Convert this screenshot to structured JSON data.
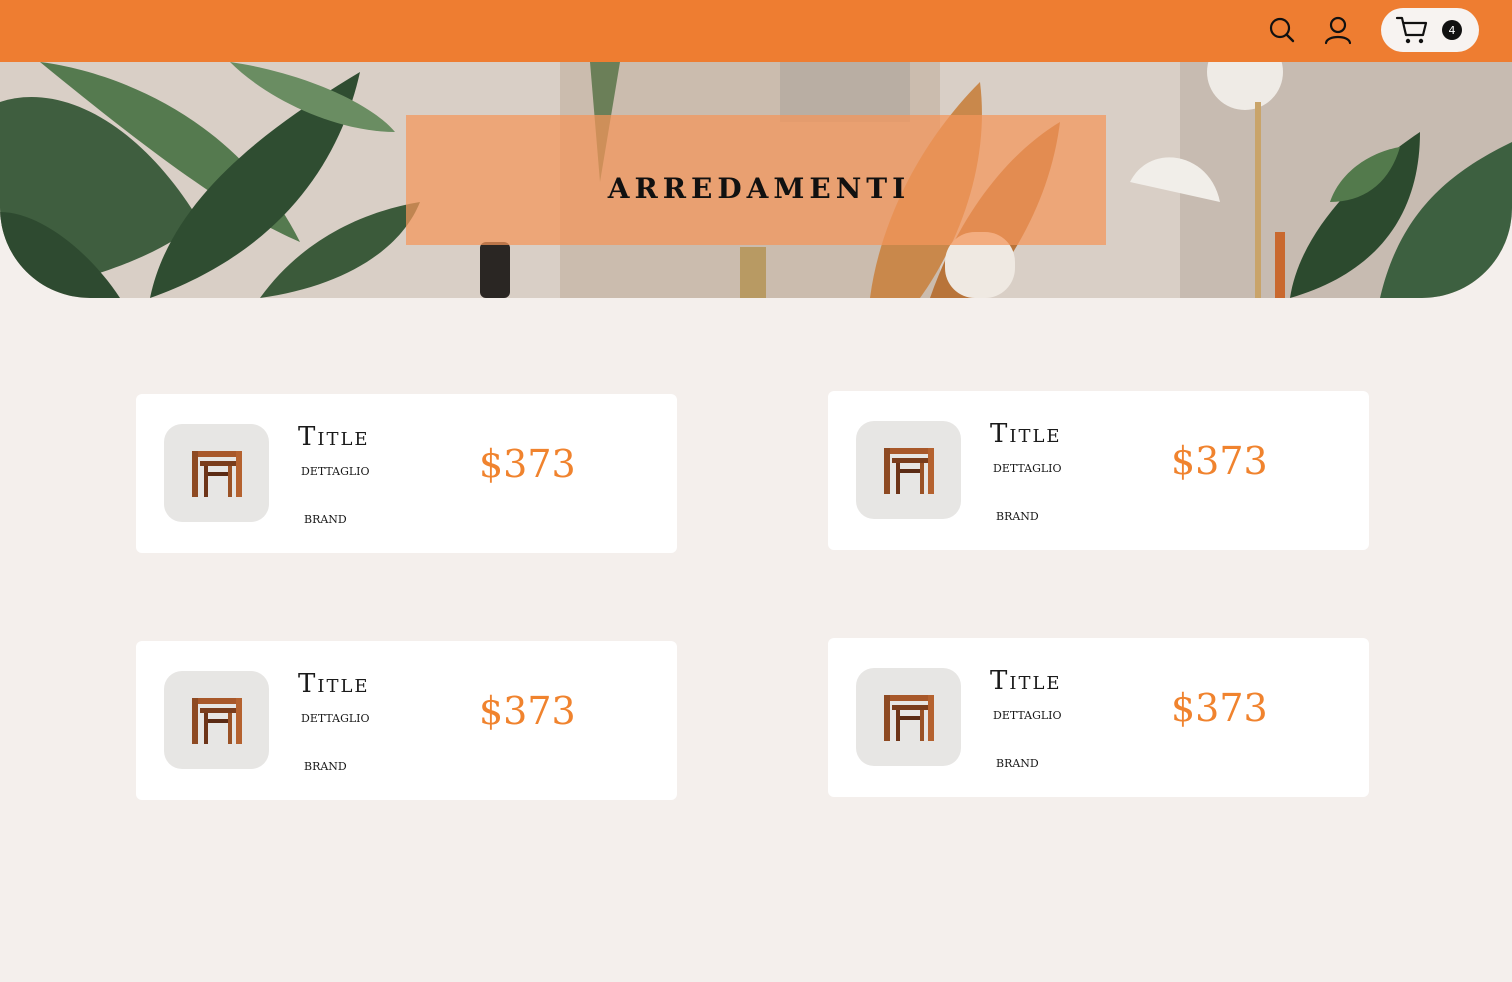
{
  "header": {
    "search_icon": "search-icon",
    "user_icon": "user-icon",
    "cart_icon": "cart-icon",
    "cart_count": "4",
    "background_color": "#ee7d31"
  },
  "hero": {
    "title": "ARREDAMENTI"
  },
  "products": [
    {
      "title": "Title",
      "detail": "DETTAGLIO",
      "brand": "BRAND",
      "price": "$373"
    },
    {
      "title": "Title",
      "detail": "DETTAGLIO",
      "brand": "BRAND",
      "price": "$373"
    },
    {
      "title": "Title",
      "detail": "DETTAGLIO",
      "brand": "BRAND",
      "price": "$373"
    },
    {
      "title": "Title",
      "detail": "DETTAGLIO",
      "brand": "BRAND",
      "price": "$373"
    }
  ],
  "colors": {
    "accent": "#ee7d31",
    "price": "#f0832e",
    "page_background": "#f4efec"
  }
}
